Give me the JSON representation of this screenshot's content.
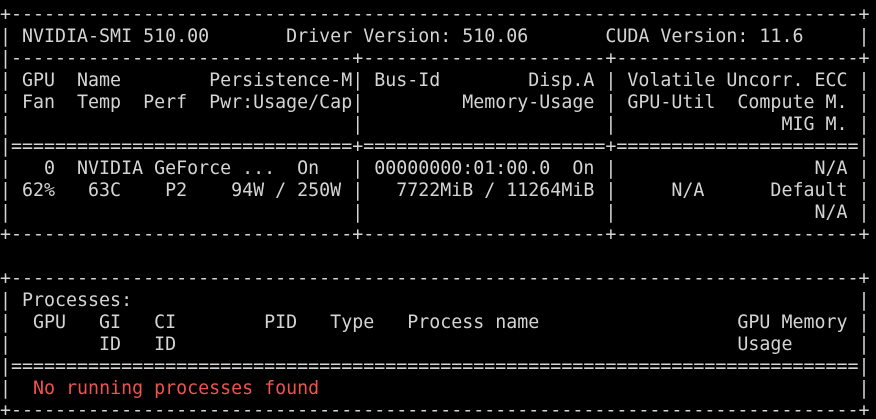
{
  "colors": {
    "background": "#000000",
    "foreground": "#d4d4d4",
    "error": "#f0524f"
  },
  "gpu_table": {
    "border_top": "+-----------------------------------------------------------------------------+",
    "header": "| NVIDIA-SMI 510.00       Driver Version: 510.06       CUDA Version: 11.6     |",
    "section_sep": "|-------------------------------+----------------------+----------------------+",
    "col_header_1": "| GPU  Name        Persistence-M| Bus-Id        Disp.A | Volatile Uncorr. ECC |",
    "col_header_2": "| Fan  Temp  Perf  Pwr:Usage/Cap|         Memory-Usage | GPU-Util  Compute M. |",
    "col_header_3": "|                               |                      |               MIG M. |",
    "header_sep": "|===============================+======================+======================|",
    "gpu_row_1": "|   0  NVIDIA GeForce ...  On   | 00000000:01:00.0  On |                  N/A |",
    "gpu_row_2": "| 62%   63C    P2    94W / 250W |   7722MiB / 11264MiB |     N/A      Default |",
    "gpu_row_3": "|                               |                      |                  N/A |",
    "border_bottom": "+-------------------------------+----------------------+----------------------+"
  },
  "process_table": {
    "border_top": "+-----------------------------------------------------------------------------+",
    "title": "| Processes:                                                                  |",
    "col_header_1": "|  GPU   GI   CI        PID   Type   Process name                  GPU Memory |",
    "col_header_2": "|        ID   ID                                                   Usage      |",
    "header_sep": "|=============================================================================|",
    "row_prefix": "|  ",
    "no_processes_message": "No running processes found",
    "row_suffix": "                                                 |",
    "border_bottom": "+-----------------------------------------------------------------------------+"
  }
}
